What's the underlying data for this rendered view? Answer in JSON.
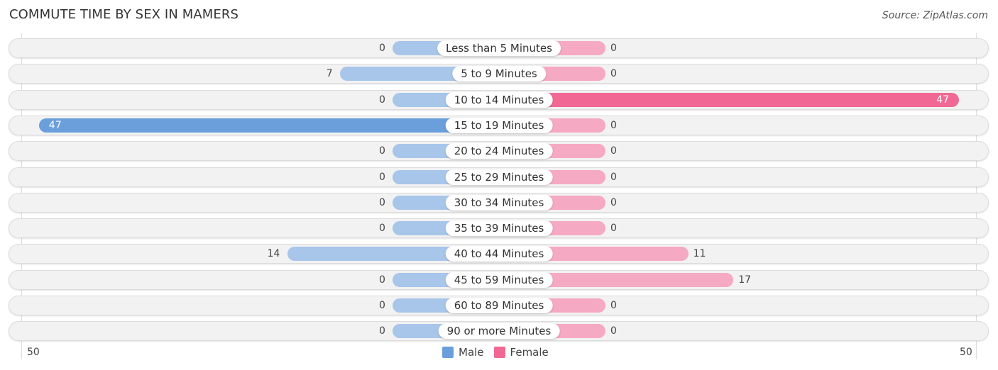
{
  "title": "COMMUTE TIME BY SEX IN MAMERS",
  "source": "Source: ZipAtlas.com",
  "colors": {
    "male": "#6a9fdc",
    "male_light": "#a7c6ea",
    "female": "#f06893",
    "female_light": "#f6a9c3"
  },
  "chart_data": {
    "type": "bar",
    "orientation": "horizontal-diverging",
    "title": "COMMUTE TIME BY SEX IN MAMERS",
    "categories": [
      "Less than 5 Minutes",
      "5 to 9 Minutes",
      "10 to 14 Minutes",
      "15 to 19 Minutes",
      "20 to 24 Minutes",
      "25 to 29 Minutes",
      "30 to 34 Minutes",
      "35 to 39 Minutes",
      "40 to 44 Minutes",
      "45 to 59 Minutes",
      "60 to 89 Minutes",
      "90 or more Minutes"
    ],
    "series": [
      {
        "name": "Male",
        "values": [
          0,
          7,
          0,
          47,
          0,
          0,
          0,
          0,
          14,
          0,
          0,
          0
        ]
      },
      {
        "name": "Female",
        "values": [
          0,
          0,
          47,
          0,
          0,
          0,
          0,
          0,
          11,
          17,
          0,
          0
        ]
      }
    ],
    "xlim": [
      -50,
      50
    ],
    "tick_labels": {
      "left": "50",
      "right": "50"
    },
    "legend": {
      "position": "bottom-center",
      "entries": [
        "Male",
        "Female"
      ]
    }
  }
}
